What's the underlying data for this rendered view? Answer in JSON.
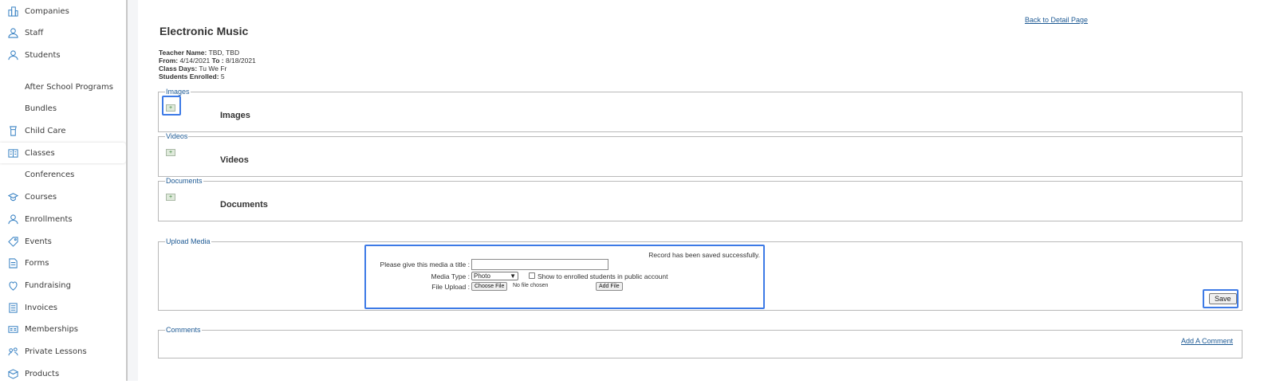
{
  "sidebar": {
    "items": [
      {
        "label": "Companies",
        "icon": "companies-icon"
      },
      {
        "label": "Staff",
        "icon": "staff-icon"
      },
      {
        "label": "Students",
        "icon": "students-icon"
      },
      {
        "label": "After School Programs",
        "icon": ""
      },
      {
        "label": "Bundles",
        "icon": ""
      },
      {
        "label": "Child Care",
        "icon": "child-care-icon"
      },
      {
        "label": "Classes",
        "icon": "classes-icon",
        "active": true
      },
      {
        "label": "Conferences",
        "icon": ""
      },
      {
        "label": "Courses",
        "icon": "courses-icon"
      },
      {
        "label": "Enrollments",
        "icon": "enrollments-icon"
      },
      {
        "label": "Events",
        "icon": "events-icon"
      },
      {
        "label": "Forms",
        "icon": "forms-icon"
      },
      {
        "label": "Fundraising",
        "icon": "fundraising-icon"
      },
      {
        "label": "Invoices",
        "icon": "invoices-icon"
      },
      {
        "label": "Memberships",
        "icon": "memberships-icon"
      },
      {
        "label": "Private Lessons",
        "icon": "private-lessons-icon"
      },
      {
        "label": "Products",
        "icon": "products-icon"
      }
    ]
  },
  "page": {
    "title": "Electronic Music",
    "back_link": "Back to Detail Page",
    "info": {
      "teacher_label": "Teacher Name:",
      "teacher_value": " TBD, TBD",
      "from_label": "From:",
      "from_value": " 4/14/2021 ",
      "to_label": "To :",
      "to_value": " 8/18/2021",
      "days_label": "Class Days:",
      "days_value": " Tu We Fr",
      "enrolled_label": "Students Enrolled:",
      "enrolled_value": " 5"
    }
  },
  "images": {
    "legend": "Images",
    "title": "Images",
    "add_symbol": "+"
  },
  "videos": {
    "legend": "Videos",
    "title": "Videos",
    "add_symbol": "+"
  },
  "documents": {
    "legend": "Documents",
    "title": "Documents",
    "add_symbol": "+"
  },
  "upload": {
    "legend": "Upload Media",
    "status": "Record has been saved successfully.",
    "title_label": "Please give this media a title :",
    "title_value": "",
    "media_type_label": "Media Type :",
    "media_type_selected": "Photo",
    "show_checkbox_label": "Show to enrolled students in public account",
    "file_label": "File Upload :",
    "choose_file": "Choose File",
    "no_file": "No file chosen",
    "add_file": "Add File",
    "save": "Save"
  },
  "comments": {
    "legend": "Comments",
    "add_link": "Add A Comment"
  },
  "colors": {
    "link": "#1e5a94",
    "highlight": "#3d7ae6",
    "border": "#b9b9b9"
  }
}
